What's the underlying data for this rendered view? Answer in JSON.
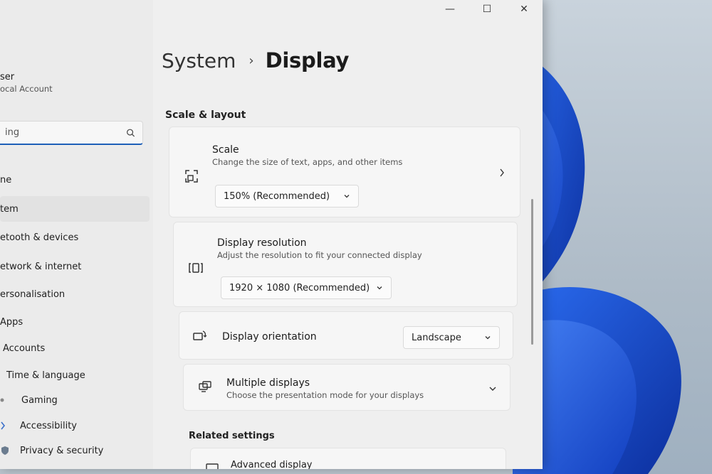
{
  "window": {
    "controls": {
      "minimize": "—",
      "maximize": "☐",
      "close": "✕"
    }
  },
  "profile": {
    "name": "ser",
    "type": "ocal Account"
  },
  "search": {
    "value": "ing"
  },
  "sidebar": {
    "items": [
      {
        "label": "ne",
        "icon": "home-icon"
      },
      {
        "label": "tem",
        "icon": "system-icon",
        "active": true
      },
      {
        "label": "etooth & devices",
        "icon": "bluetooth-icon"
      },
      {
        "label": "etwork & internet",
        "icon": "network-icon"
      },
      {
        "label": "ersonalisation",
        "icon": "brush-icon"
      },
      {
        "label": "Apps",
        "icon": "apps-icon"
      },
      {
        "label": "Accounts",
        "icon": "person-icon"
      },
      {
        "label": "Time & language",
        "icon": "clock-icon"
      },
      {
        "label": "Gaming",
        "icon": "gamepad-icon"
      },
      {
        "label": "Accessibility",
        "icon": "accessibility-icon"
      },
      {
        "label": "Privacy & security",
        "icon": "shield-icon"
      }
    ]
  },
  "breadcrumb": {
    "parent": "System",
    "separator": "›",
    "current": "Display"
  },
  "section": {
    "title": "Scale & layout"
  },
  "scale": {
    "title": "Scale",
    "subtitle": "Change the size of text, apps, and other items",
    "value": "150% (Recommended)"
  },
  "resolution": {
    "title": "Display resolution",
    "subtitle": "Adjust the resolution to fit your connected display",
    "value": "1920 × 1080 (Recommended)"
  },
  "orientation": {
    "title": "Display orientation",
    "value": "Landscape"
  },
  "multiple": {
    "title": "Multiple displays",
    "subtitle": "Choose the presentation mode for your displays"
  },
  "related": {
    "title": "Related settings",
    "advanced": "Advanced display"
  },
  "colors": {
    "accent": "#1d5fb8",
    "wallpaper_blue": "#1a4fd6"
  }
}
